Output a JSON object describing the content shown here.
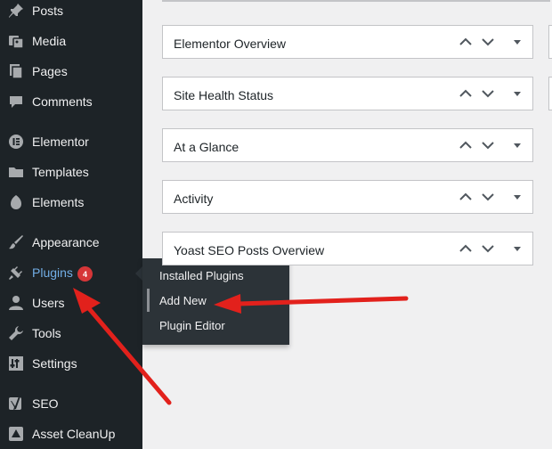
{
  "sidebar": {
    "items": [
      {
        "label": "Posts",
        "icon": "pushpin-icon"
      },
      {
        "label": "Media",
        "icon": "media-icon"
      },
      {
        "label": "Pages",
        "icon": "pages-icon"
      },
      {
        "label": "Comments",
        "icon": "comments-icon"
      },
      {
        "label": "Elementor",
        "icon": "elementor-icon"
      },
      {
        "label": "Templates",
        "icon": "folder-icon"
      },
      {
        "label": "Elements",
        "icon": "elements-icon"
      },
      {
        "label": "Appearance",
        "icon": "paintbrush-icon"
      },
      {
        "label": "Plugins",
        "icon": "plug-icon",
        "badge": "4"
      },
      {
        "label": "Users",
        "icon": "user-icon"
      },
      {
        "label": "Tools",
        "icon": "wrench-icon"
      },
      {
        "label": "Settings",
        "icon": "settings-icon"
      },
      {
        "label": "SEO",
        "icon": "yoast-icon"
      },
      {
        "label": "Asset CleanUp",
        "icon": "asset-cleanup-icon"
      }
    ]
  },
  "flyout": {
    "items": [
      {
        "label": "Installed Plugins"
      },
      {
        "label": "Add New"
      },
      {
        "label": "Plugin Editor"
      }
    ]
  },
  "dashboard": {
    "boxes": [
      {
        "title": "Elementor Overview"
      },
      {
        "title": "Site Health Status"
      },
      {
        "title": "At a Glance"
      },
      {
        "title": "Activity"
      },
      {
        "title": "Yoast SEO Posts Overview"
      }
    ]
  },
  "colors": {
    "sidebar_bg": "#1d2327",
    "flyout_bg": "#2c3338",
    "badge": "#d63638",
    "annotation_arrow": "#e2211c",
    "page_bg": "#f0f0f1"
  }
}
